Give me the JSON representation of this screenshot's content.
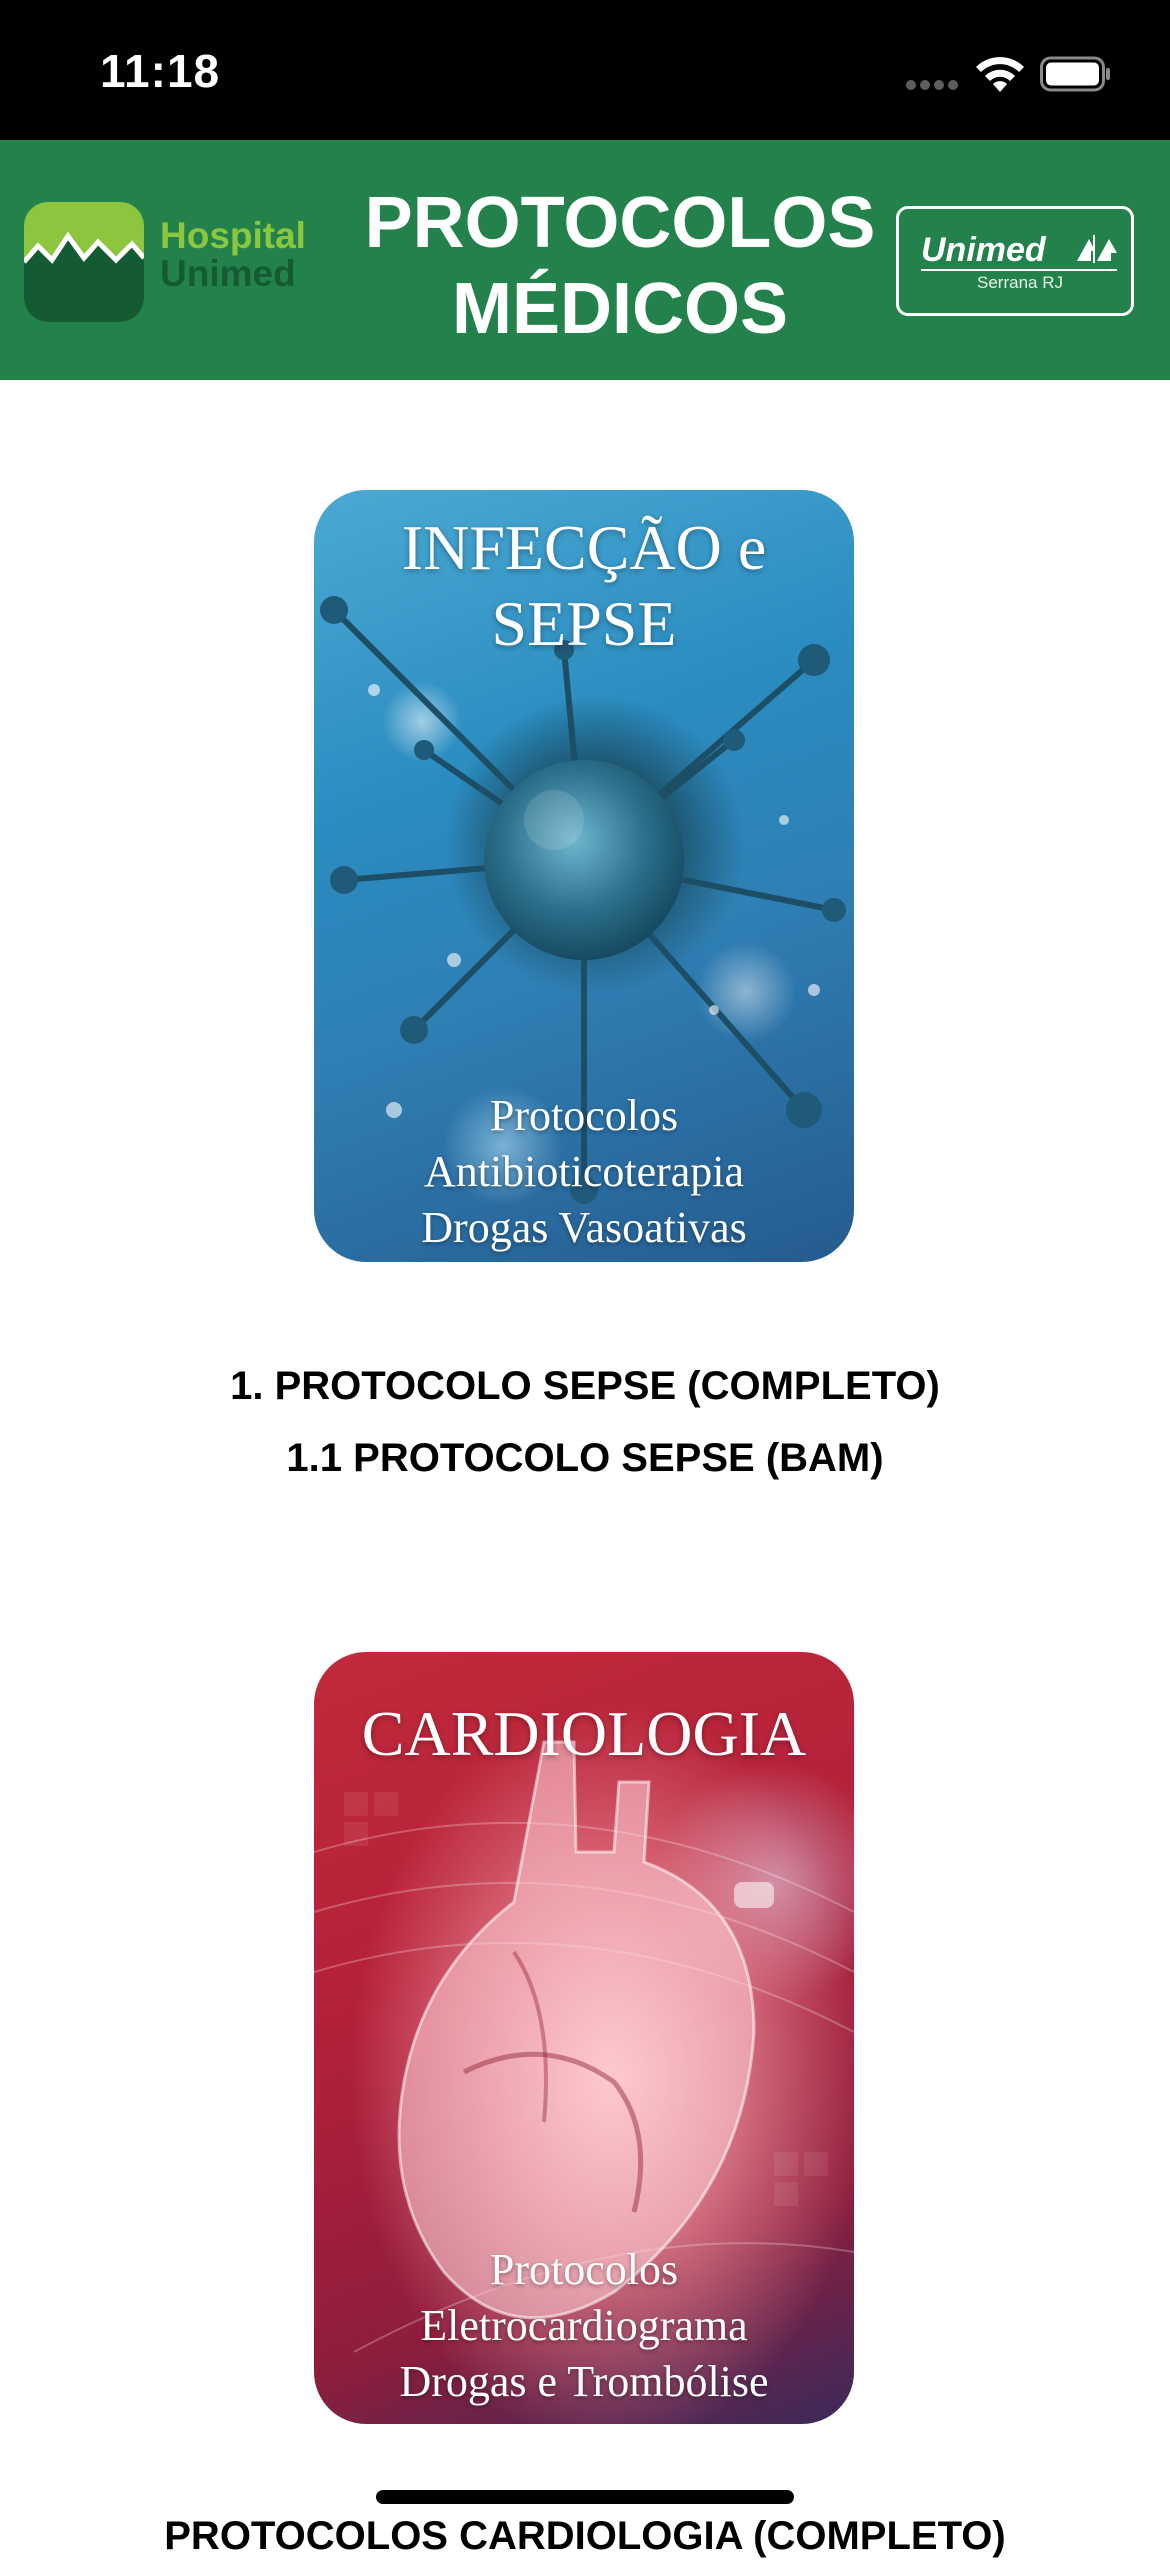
{
  "status_bar": {
    "time": "11:18"
  },
  "header": {
    "title_line1": "PROTOCOLOS",
    "title_line2": "MÉDICOS",
    "hospital_logo": {
      "word1": "Hospital",
      "word2": "Unimed"
    },
    "unimed_logo": {
      "word": "Unimed",
      "sub": "Serrana RJ"
    },
    "colors": {
      "header_green": "#23824b",
      "logo_lime": "#8cc63f"
    }
  },
  "cards": [
    {
      "title_line1": "INFECÇÃO e",
      "title_line2": "SEPSE",
      "subtitle_line1": "Protocolos",
      "subtitle_line2": "Antibioticoterapia",
      "subtitle_line3": "Drogas Vasoativas",
      "links": [
        "1. PROTOCOLO SEPSE (COMPLETO)",
        "1.1 PROTOCOLO SEPSE (BAM)"
      ]
    },
    {
      "title_line1": "CARDIOLOGIA",
      "subtitle_line1": "Protocolos",
      "subtitle_line2": "Eletrocardiograma",
      "subtitle_line3": "Drogas e Trombólise",
      "links": [
        "PROTOCOLOS CARDIOLOGIA (COMPLETO)"
      ]
    }
  ]
}
